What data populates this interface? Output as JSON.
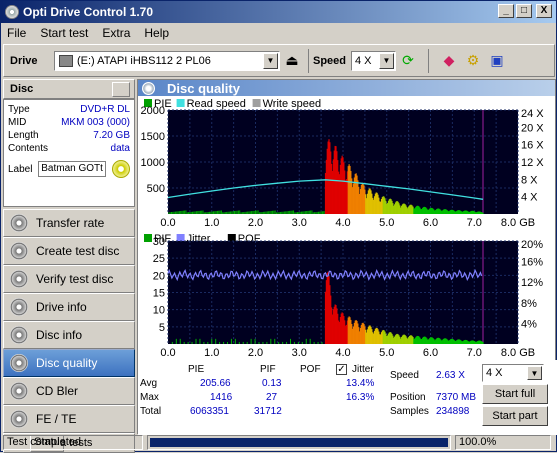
{
  "window": {
    "title": "Opti Drive Control 1.70",
    "btn_min": "_",
    "btn_max": "□",
    "btn_close": "X"
  },
  "menu": [
    "File",
    "Start test",
    "Extra",
    "Help"
  ],
  "toolbar": {
    "drive_label": "Drive",
    "drive_value": "(E:)   ATAPI  iHBS112   2 PL06",
    "speed_label": "Speed",
    "speed_value": "4 X"
  },
  "disc": {
    "header": "Disc",
    "rows": [
      {
        "k": "Type",
        "v": "DVD+R DL"
      },
      {
        "k": "MID",
        "v": "MKM 003 (000)"
      },
      {
        "k": "Length",
        "v": "7.20 GB"
      },
      {
        "k": "Contents",
        "v": "data"
      }
    ],
    "label_key": "Label",
    "label_value": "Batman GOTt"
  },
  "nav": [
    {
      "label": "Transfer rate",
      "active": false
    },
    {
      "label": "Create test disc",
      "active": false
    },
    {
      "label": "Verify test disc",
      "active": false
    },
    {
      "label": "Drive info",
      "active": false
    },
    {
      "label": "Disc info",
      "active": false
    },
    {
      "label": "Disc quality",
      "active": true
    },
    {
      "label": "CD Bler",
      "active": false
    },
    {
      "label": "FE / TE",
      "active": false
    }
  ],
  "nav_partial": "Statu",
  "nav_partial2": "a tests",
  "panel": {
    "title": "Disc quality"
  },
  "chart_data": [
    {
      "type": "bar",
      "legend": [
        "PIE",
        "Read speed",
        "Write speed"
      ],
      "legend_colors": [
        "#00a000",
        "#40e0e0",
        "#a0a0a0"
      ],
      "x_ticks": [
        "0.0",
        "0.5",
        "1.0",
        "1.5",
        "2.0",
        "2.5",
        "3.0",
        "3.5",
        "4.0",
        "4.5",
        "5.0",
        "5.5",
        "6.0",
        "6.5",
        "7.0",
        "7.5",
        "8.0 GB"
      ],
      "y_left_ticks": [
        "2000",
        "1500",
        "1000",
        "500"
      ],
      "y_right_ticks": [
        "24 X",
        "20 X",
        "16 X",
        "12 X",
        "8 X",
        "4 X"
      ],
      "xlim": [
        0,
        8
      ],
      "ylim": [
        0,
        2000
      ],
      "layer_break_gb": 3.6,
      "disc_end_gb": 7.2,
      "pie_peak": [
        [
          3.6,
          1400
        ],
        [
          3.7,
          1450
        ],
        [
          3.9,
          1250
        ],
        [
          4.0,
          1100
        ],
        [
          4.2,
          900
        ],
        [
          4.5,
          550
        ],
        [
          4.9,
          350
        ],
        [
          5.4,
          200
        ],
        [
          6.0,
          120
        ],
        [
          6.5,
          80
        ],
        [
          7.0,
          60
        ],
        [
          7.2,
          40
        ]
      ],
      "read_speed": [
        [
          0.0,
          3.8
        ],
        [
          0.5,
          4.6
        ],
        [
          1.0,
          5.3
        ],
        [
          1.5,
          6.0
        ],
        [
          2.0,
          6.6
        ],
        [
          2.5,
          7.1
        ],
        [
          3.0,
          7.6
        ],
        [
          3.6,
          7.9
        ],
        [
          4.0,
          7.6
        ],
        [
          4.5,
          7.0
        ],
        [
          5.0,
          6.4
        ],
        [
          5.5,
          5.8
        ],
        [
          6.0,
          5.1
        ],
        [
          6.5,
          4.4
        ],
        [
          7.0,
          3.7
        ],
        [
          7.2,
          3.4
        ]
      ]
    },
    {
      "type": "bar",
      "legend": [
        "PIF",
        "Jitter",
        "POF"
      ],
      "legend_colors": [
        "#00a000",
        "#8080ff",
        "#000000"
      ],
      "x_ticks": [
        "0.0",
        "0.5",
        "1.0",
        "1.5",
        "2.0",
        "2.5",
        "3.0",
        "3.5",
        "4.0",
        "4.5",
        "5.0",
        "5.5",
        "6.0",
        "6.5",
        "7.0",
        "7.5",
        "8.0 GB"
      ],
      "y_left_ticks": [
        "30",
        "25",
        "20",
        "15",
        "10",
        "5"
      ],
      "y_right_ticks": [
        "20%",
        "16%",
        "12%",
        "8%",
        "4%"
      ],
      "xlim": [
        0,
        8
      ],
      "ylim": [
        0,
        30
      ],
      "pif_peak": [
        [
          3.6,
          27
        ],
        [
          3.7,
          18
        ],
        [
          3.8,
          12
        ],
        [
          4.0,
          9
        ],
        [
          4.3,
          7
        ],
        [
          4.7,
          5
        ],
        [
          5.2,
          3
        ],
        [
          6.0,
          2
        ],
        [
          7.0,
          1
        ]
      ],
      "jitter_pct": 13.4
    }
  ],
  "stats": {
    "headers": [
      "PIE",
      "PIF",
      "POF"
    ],
    "jitter_label": "Jitter",
    "rows": [
      {
        "label": "Avg",
        "pie": "205.66",
        "pif": "0.13",
        "pof": "",
        "jitter": "13.4%"
      },
      {
        "label": "Max",
        "pie": "1416",
        "pif": "27",
        "pof": "",
        "jitter": "16.3%"
      },
      {
        "label": "Total",
        "pie": "6063351",
        "pif": "31712",
        "pof": "",
        "jitter": ""
      }
    ],
    "speed_label": "Speed",
    "speed_value": "2.63 X",
    "speed_select": "4 X",
    "position_label": "Position",
    "position_value": "7370 MB",
    "samples_label": "Samples",
    "samples_value": "234898",
    "start_full": "Start full",
    "start_part": "Start part"
  },
  "status": {
    "text": "Test completed",
    "progress": 1.0,
    "progress_label": "100.0%"
  }
}
